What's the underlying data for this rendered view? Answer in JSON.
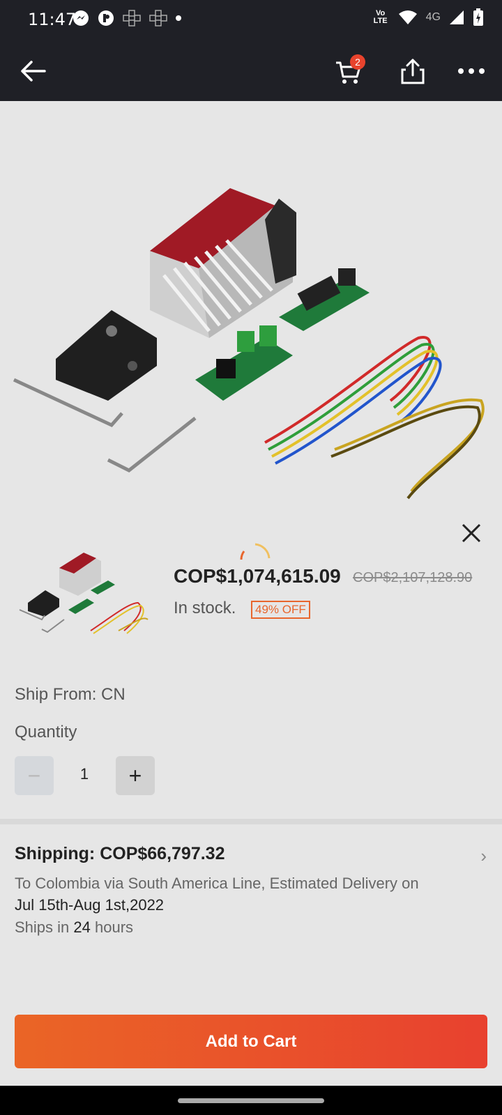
{
  "status_bar": {
    "time": "11:47",
    "network": "4G",
    "volte": "Vo LTE",
    "icons": [
      "messenger-icon",
      "app-icon",
      "game-icon",
      "game-icon",
      "dot-icon",
      "volte-icon",
      "wifi-icon",
      "signal-icon",
      "battery-icon"
    ]
  },
  "app_bar": {
    "cart_count": "2"
  },
  "product": {
    "price": "COP$1,074,615.09",
    "original_price": "COP$2,107,128.90",
    "stock": "In stock.",
    "discount": "49% OFF",
    "ship_from": "Ship From: CN"
  },
  "quantity": {
    "label": "Quantity",
    "minus": "−",
    "plus": "+",
    "value": "1"
  },
  "shipping": {
    "title": "Shipping: COP$66,797.32",
    "line1": "To Colombia via South America Line, Estimated Delivery on",
    "line2": "Jul 15th-Aug 1st,2022",
    "line3_prefix": "Ships in ",
    "line3_value": "24",
    "line3_suffix": " hours",
    "chevron": "›"
  },
  "actions": {
    "add_to_cart": "Add to Cart"
  },
  "colors": {
    "accent": "#e8662d",
    "button_start": "#ea6526",
    "button_end": "#e8412f",
    "badge": "#e8432d"
  }
}
